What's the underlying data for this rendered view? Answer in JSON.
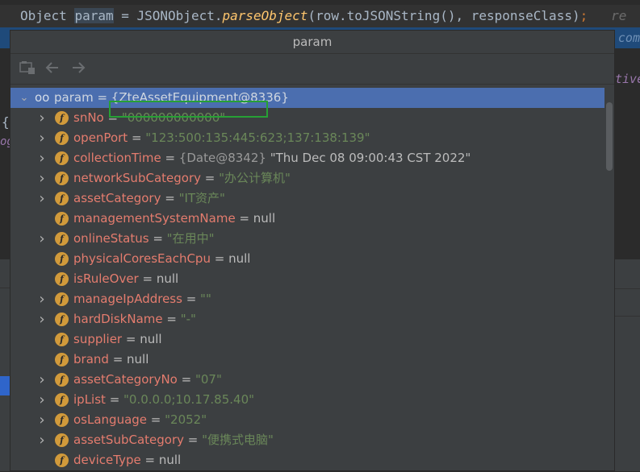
{
  "editor": {
    "code_prefix": "Object ",
    "code_var": "param",
    "code_mid": " = JSONObject.",
    "code_method": "parseObject",
    "code_args": "(row.toJSONString(), responseClass)",
    "code_semi": ";",
    "code_tail": "re",
    "right_tail_top": "com",
    "right_tail_mid": "tive",
    "left_brace": "{",
    "left_og": "og"
  },
  "popup": {
    "title": "param",
    "toolbar": {
      "tree_icon": "tree-icon",
      "back_icon": "arrow-left-icon",
      "forward_icon": "arrow-right-icon"
    },
    "root": {
      "glasses": "oo",
      "text": "param = {ZteAssetEquipment@8336}"
    },
    "fields": [
      {
        "name": "snNo",
        "value": "\"000000000000\"",
        "kind": "str",
        "expandable": true
      },
      {
        "name": "openPort",
        "value": "\"123:500:135:445:623;137:138:139\"",
        "kind": "str",
        "expandable": true
      },
      {
        "name": "collectionTime",
        "ref": "{Date@8342}",
        "value": "\"Thu Dec 08 09:00:43 CST 2022\"",
        "kind": "plain",
        "expandable": true
      },
      {
        "name": "networkSubCategory",
        "value": "\"办公计算机\"",
        "kind": "str",
        "expandable": true
      },
      {
        "name": "assetCategory",
        "value": "\"IT资产\"",
        "kind": "str",
        "expandable": true
      },
      {
        "name": "managementSystemName",
        "value": "null",
        "kind": "nul",
        "expandable": false
      },
      {
        "name": "onlineStatus",
        "value": "\"在用中\"",
        "kind": "str",
        "expandable": true
      },
      {
        "name": "physicalCoresEachCpu",
        "value": "null",
        "kind": "nul",
        "expandable": false
      },
      {
        "name": "isRuleOver",
        "value": "null",
        "kind": "nul",
        "expandable": false
      },
      {
        "name": "manageIpAddress",
        "value": "\"\"",
        "kind": "str",
        "expandable": true
      },
      {
        "name": "hardDiskName",
        "value": "\"-\"",
        "kind": "str",
        "expandable": true
      },
      {
        "name": "supplier",
        "value": "null",
        "kind": "nul",
        "expandable": false
      },
      {
        "name": "brand",
        "value": "null",
        "kind": "nul",
        "expandable": false
      },
      {
        "name": "assetCategoryNo",
        "value": "\"07\"",
        "kind": "str",
        "expandable": true
      },
      {
        "name": "ipList",
        "value": "\"0.0.0.0;10.17.85.40\"",
        "kind": "str",
        "expandable": true
      },
      {
        "name": "osLanguage",
        "value": "\"2052\"",
        "kind": "str",
        "expandable": true
      },
      {
        "name": "assetSubCategory",
        "value": "\"便携式电脑\"",
        "kind": "str",
        "expandable": true
      },
      {
        "name": "deviceType",
        "value": "null",
        "kind": "nul",
        "expandable": false
      }
    ]
  },
  "colors": {
    "field_name": "#e47c6e",
    "string_value": "#6a8759",
    "selection": "#4b6eaf",
    "highlight_box": "#27a035",
    "badge": "#d19a3b"
  }
}
